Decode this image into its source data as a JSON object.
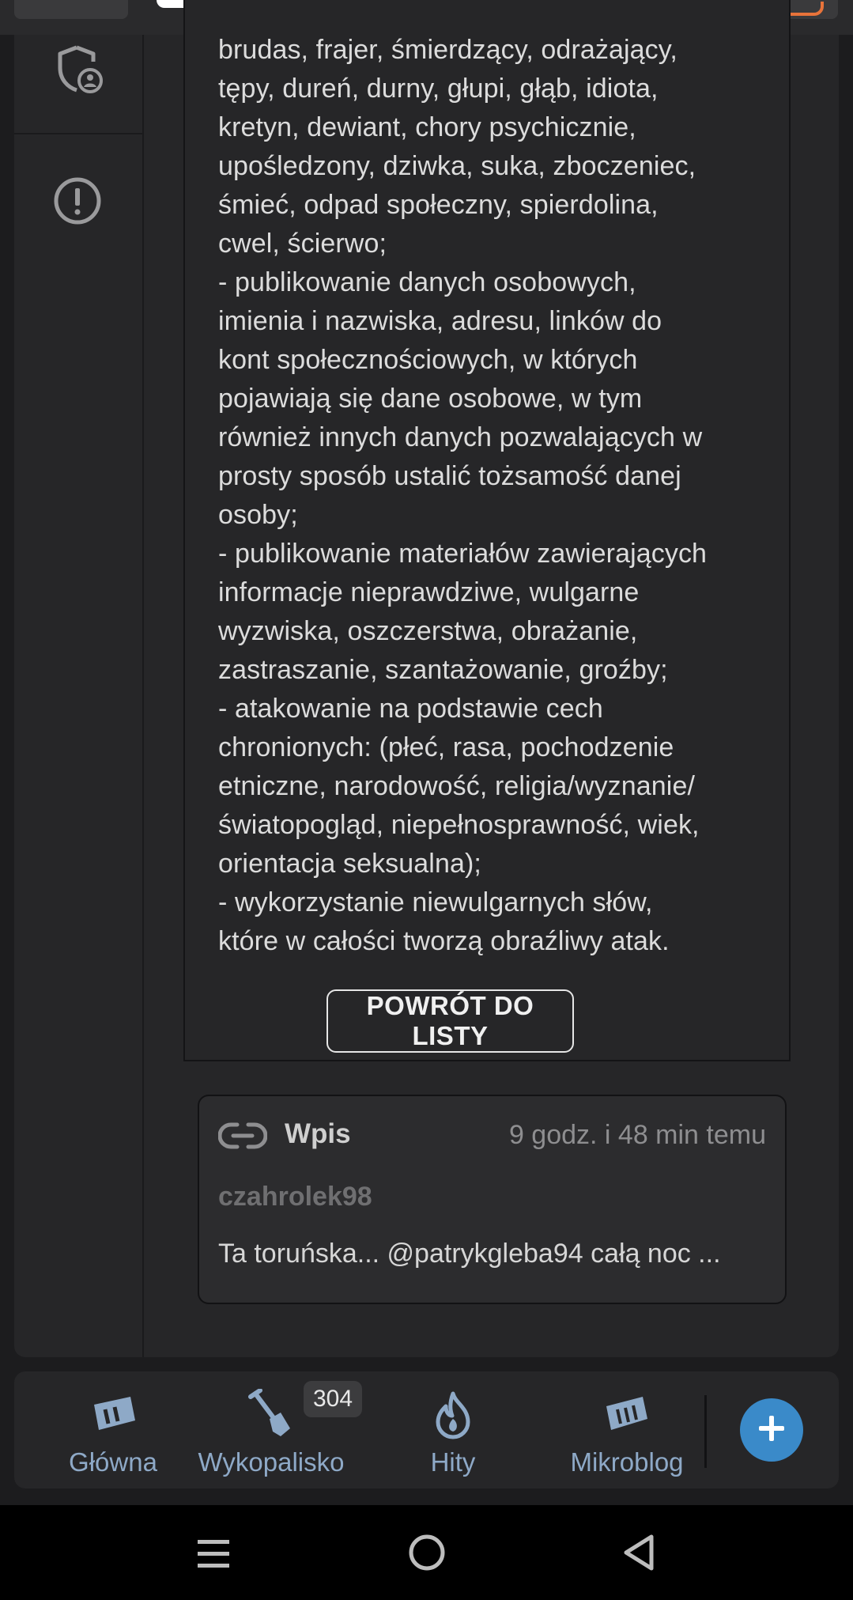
{
  "article": {
    "body": "brudas, frajer, śmierdzący, odrażający,\ntępy, dureń, durny, głupi, głąb, idiota,\nkretyn, dewiant, chory psychicznie,\nupośledzony, dziwka, suka, zboczeniec,\nśmieć, odpad społeczny, spierdolina,\ncwel, ścierwo;\n- publikowanie danych osobowych,\nimienia i nazwiska, adresu, linków do\nkont społecznościowych, w których\npojawiają się dane osobowe, w tym\nrównież innych danych pozwalających w\nprosty sposób ustalić tożsamość danej\nosoby;\n- publikowanie materiałów zawierających\ninformacje nieprawdziwe, wulgarne\nwyzwiska, oszczerstwa, obrażanie,\nzastraszanie, szantażowanie, groźby;\n- atakowanie na podstawie cech\nchronionych: (płeć, rasa, pochodzenie\netniczne, narodowość, religia/wyznanie/\nświatopogląd, niepełnosprawność, wiek,\norientacja seksualna);\n- wykorzystanie niewulgarnych słów,\nktóre w całości tworzą obraźliwy atak.",
    "back_button": "POWRÓT DO LISTY"
  },
  "left_rail": {
    "icons": [
      "shield-user-icon",
      "alert-circle-icon"
    ]
  },
  "related": {
    "type_icon": "link-icon",
    "type": "Wpis",
    "time": "9 godz. i 48 min temu",
    "author": "czahrolek98",
    "excerpt": "Ta toruńska... @patrykgleba94 całą noc ..."
  },
  "bottom_nav": {
    "items": [
      {
        "label": "Główna",
        "icon": "wykop-home-icon"
      },
      {
        "label": "Wykopalisko",
        "icon": "shovel-icon",
        "badge": "304"
      },
      {
        "label": "Hity",
        "icon": "fire-icon"
      },
      {
        "label": "Mikroblog",
        "icon": "mikroblog-icon"
      }
    ],
    "add_icon": "plus-icon"
  },
  "colors": {
    "accent": "#3a8ac9",
    "nav_label": "#8ea9c7",
    "background": "#1c1c1e",
    "panel": "#262628"
  },
  "system_bar": {
    "icons": [
      "menu-icon",
      "home-circle-icon",
      "back-triangle-icon"
    ]
  }
}
